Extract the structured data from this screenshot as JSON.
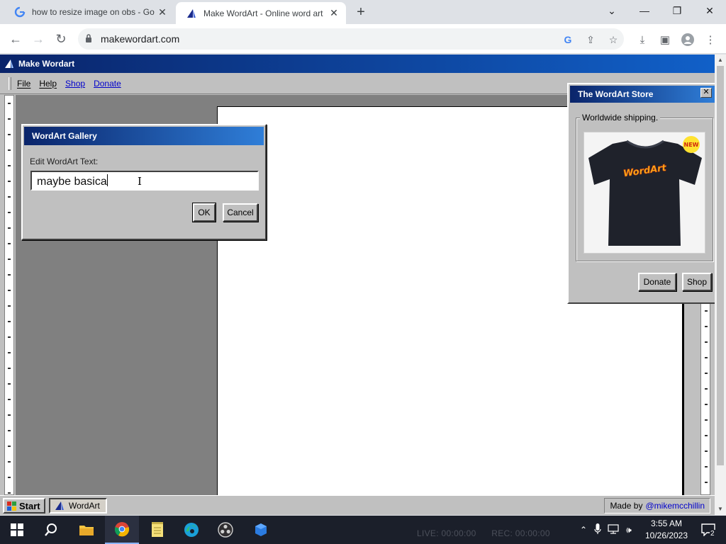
{
  "browser": {
    "tabs": [
      {
        "title": "how to resize image on obs - Go",
        "active": false
      },
      {
        "title": "Make WordArt - Online word art",
        "active": true
      }
    ],
    "url": "makewordart.com"
  },
  "app": {
    "title": "Make Wordart",
    "menu": {
      "file": "File",
      "help": "Help",
      "shop": "Shop",
      "donate": "Donate"
    }
  },
  "dialog": {
    "title": "WordArt Gallery",
    "label": "Edit WordArt Text:",
    "input_value": "maybe basica",
    "ok": "OK",
    "cancel": "Cancel"
  },
  "store": {
    "title": "The WordArt Store",
    "shipping": "Worldwide shipping.",
    "badge": "NEW",
    "shirt_text": "WordArt",
    "donate": "Donate",
    "shop": "Shop"
  },
  "statusbar": {
    "start": "Start",
    "task": "WordArt",
    "madeby": "Made by",
    "handle": "@mikemcchillin"
  },
  "taskbar": {
    "obs_live": "LIVE: 00:00:00",
    "obs_rec": "REC: 00:00:00",
    "time": "3:55 AM",
    "date": "10/26/2023",
    "notifications": "2"
  },
  "colors": {
    "titlebar_start": "#0a246a",
    "titlebar_end": "#2f7ed8",
    "win95_gray": "#c0c0c0",
    "link": "#0000cc"
  }
}
